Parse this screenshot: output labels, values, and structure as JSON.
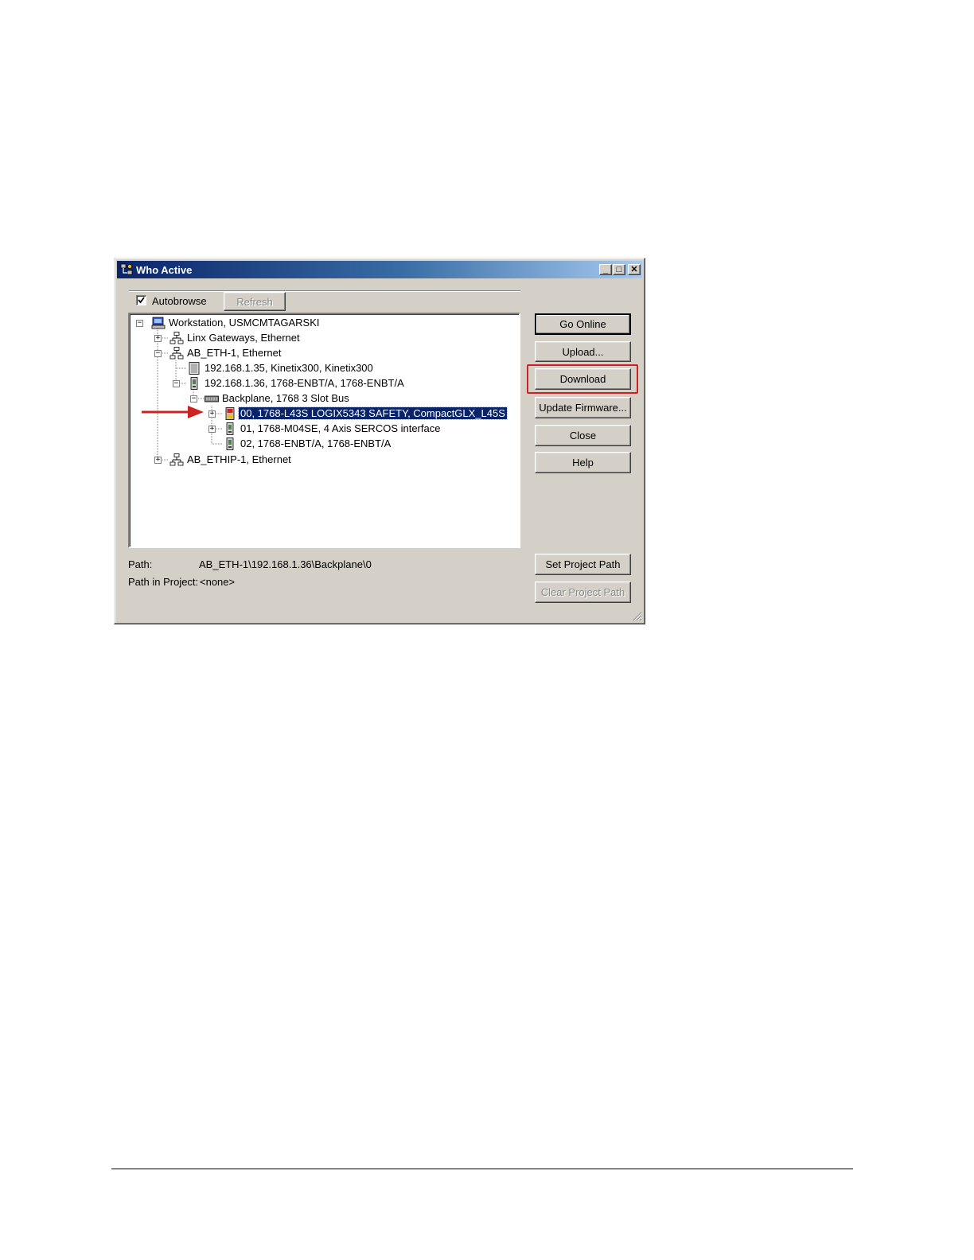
{
  "window": {
    "title": "Who Active",
    "controls": {
      "minimize": "_",
      "maximize": "□",
      "close": "✕"
    }
  },
  "autobrowse": {
    "label": "Autobrowse",
    "checked": true
  },
  "refresh_label": "Refresh",
  "tree": {
    "workstation": "Workstation, USMCMTAGARSKI",
    "linx": "Linx Gateways, Ethernet",
    "ab_eth": "AB_ETH-1, Ethernet",
    "kinetix": "192.168.1.35, Kinetix300, Kinetix300",
    "enbt": "192.168.1.36, 1768-ENBT/A, 1768-ENBT/A",
    "backplane": "Backplane, 1768 3 Slot Bus",
    "slot00": "00, 1768-L43S LOGIX5343 SAFETY, CompactGLX_L45S",
    "slot01": "01, 1768-M04SE, 4 Axis SERCOS interface",
    "slot02": "02, 1768-ENBT/A, 1768-ENBT/A",
    "ab_ethip": "AB_ETHIP-1, Ethernet"
  },
  "buttons": {
    "go_online": "Go Online",
    "upload": "Upload...",
    "download": "Download",
    "update_firmware": "Update Firmware...",
    "close": "Close",
    "help": "Help",
    "set_project_path": "Set Project Path",
    "clear_project_path": "Clear Project Path"
  },
  "path": {
    "label": "Path:",
    "value": "AB_ETH-1\\192.168.1.36\\Backplane\\0",
    "project_label": "Path in Project:",
    "project_value": "<none>"
  },
  "colors": {
    "highlight": "#cc2222",
    "selection": "#0a246a"
  }
}
